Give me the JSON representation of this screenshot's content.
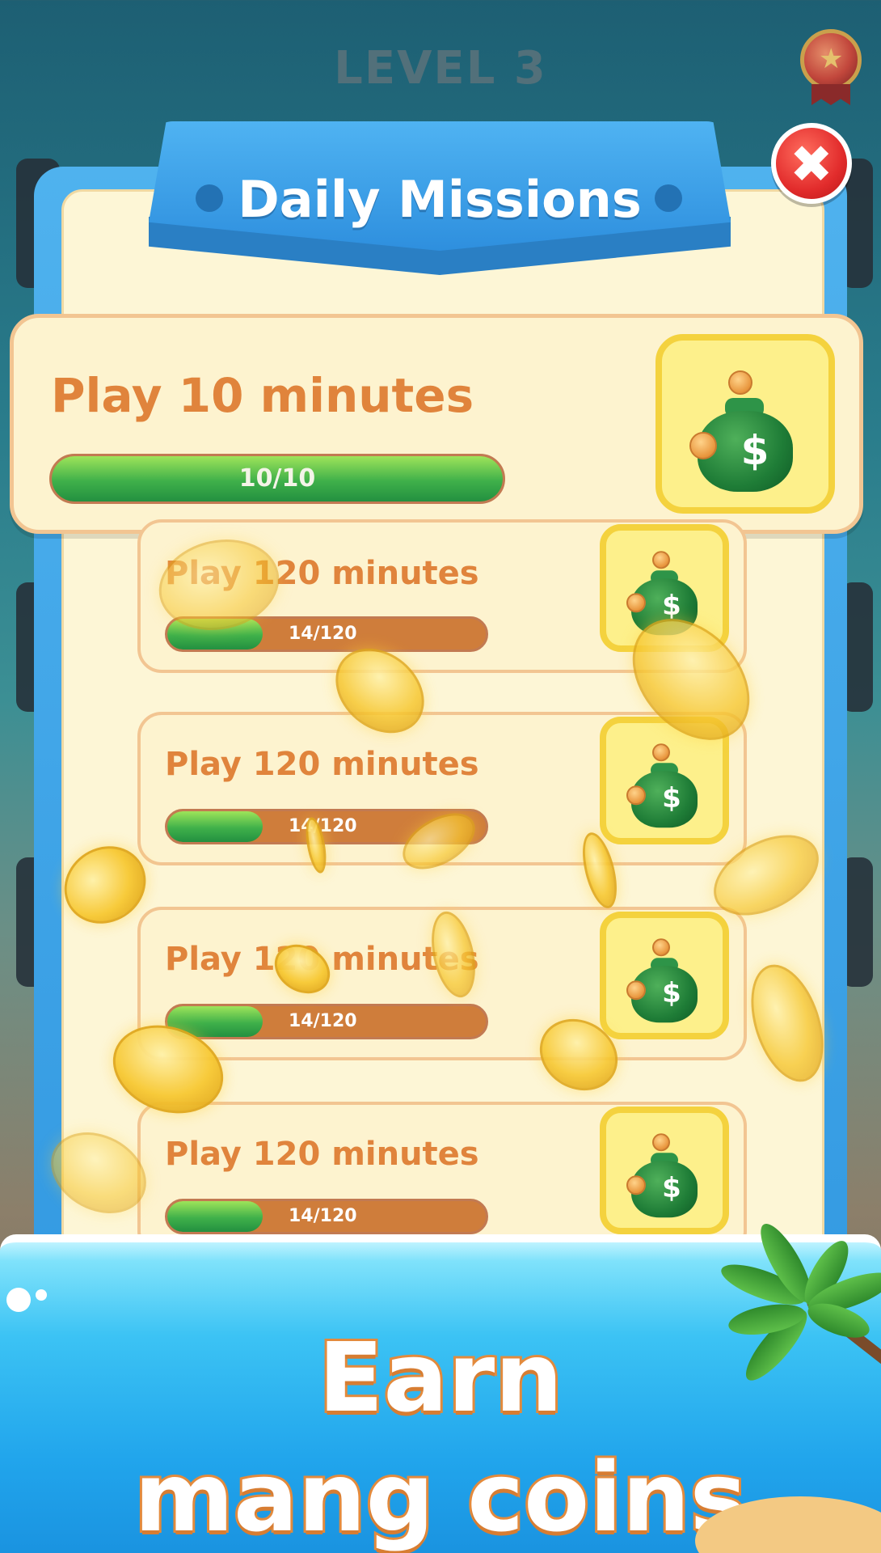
{
  "background": {
    "level_title": "LEVEL 3"
  },
  "modal": {
    "title": "Daily Missions",
    "close_icon": "close-icon",
    "featured_mission": {
      "label": "Play 10 minutes",
      "progress_text": "10/10",
      "progress": 1.0,
      "reward_icon": "money-bag-icon"
    },
    "missions": [
      {
        "label": "Play 120 minutes",
        "progress_text": "14/120",
        "progress": 0.3,
        "reward_icon": "money-bag-icon"
      },
      {
        "label": "Play 120 minutes",
        "progress_text": "14/120",
        "progress": 0.3,
        "reward_icon": "money-bag-icon"
      },
      {
        "label": "Play 120 minutes",
        "progress_text": "14/120",
        "progress": 0.3,
        "reward_icon": "money-bag-icon"
      },
      {
        "label": "Play 120 minutes",
        "progress_text": "14/120",
        "progress": 0.3,
        "reward_icon": "money-bag-icon"
      }
    ]
  },
  "banner": {
    "line1": "Earn",
    "line2": "mang coins"
  },
  "colors": {
    "mission_text": "#e0843c",
    "progress_green": "#3fb04a",
    "progress_track": "#cf7d3b",
    "panel_blue": "#2f96e0",
    "reward_yellow": "#fdf08b"
  }
}
